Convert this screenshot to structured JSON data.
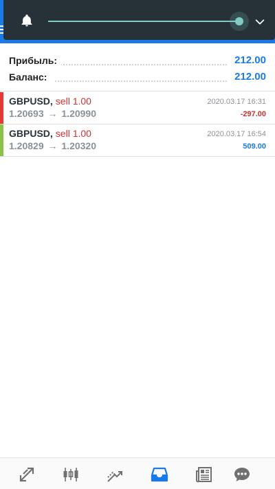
{
  "colors": {
    "accent": "#1a7be8",
    "header_bg": "#263238",
    "slider": "#80cbc4",
    "loss": "#d32f2f",
    "profit": "#1a7be8",
    "muted": "#8a9299"
  },
  "header": {
    "bell_icon": "bell-icon",
    "menu_icon": "menu-icon",
    "chevron_icon": "chevron-down-icon"
  },
  "summary": {
    "profit_label": "Прибыль:",
    "profit_value": "212.00",
    "balance_label": "Баланс:",
    "balance_value": "212.00"
  },
  "trades": [
    {
      "symbol": "GBPUSD",
      "separator": ",",
      "action": "sell 1.00",
      "open_price": "1.20693",
      "arrow": "→",
      "close_price": "1.20990",
      "time": "2020.03.17 16:31",
      "profit": "-297.00",
      "bar_color": "#e53935",
      "profit_color": "#d32f2f"
    },
    {
      "symbol": "GBPUSD",
      "separator": ",",
      "action": "sell 1.00",
      "open_price": "1.20829",
      "arrow": "→",
      "close_price": "1.20320",
      "time": "2020.03.17 16:54",
      "profit": "509.00",
      "bar_color": "#8bc34a",
      "profit_color": "#1a7be8"
    }
  ],
  "bottom_nav": [
    {
      "icon": "quotes-icon",
      "active": false
    },
    {
      "icon": "chart-icon",
      "active": false
    },
    {
      "icon": "trade-icon",
      "active": false
    },
    {
      "icon": "history-icon",
      "active": true
    },
    {
      "icon": "news-icon",
      "active": false
    },
    {
      "icon": "messages-icon",
      "active": false
    }
  ]
}
